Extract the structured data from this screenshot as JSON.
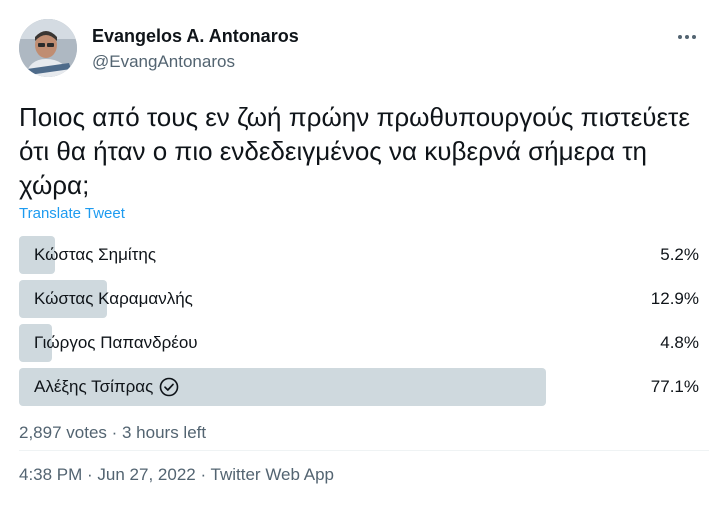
{
  "author": {
    "name": "Evangelos A. Antonaros",
    "handle": "@EvangAntonaros"
  },
  "more_icon": "more-horizontal-icon",
  "tweet_text": "Ποιος από τους εν ζωή πρώην πρωθυπουργούς πιστεύετε ότι θα ήταν ο πιο ενδεδειγμένος να κυβερνά σήμερα τη χώρα;",
  "translate_label": "Translate Tweet",
  "poll": {
    "options": [
      {
        "label": "Κώστας Σημίτης",
        "percent_label": "5.2%",
        "percent": 5.2,
        "winner": false
      },
      {
        "label": "Κώστας Καραμανλής",
        "percent_label": "12.9%",
        "percent": 12.9,
        "winner": false
      },
      {
        "label": "Γιώργος Παπανδρέου",
        "percent_label": "4.8%",
        "percent": 4.8,
        "winner": false
      },
      {
        "label": "Αλέξης Τσίπρας",
        "percent_label": "77.1%",
        "percent": 77.1,
        "winner": true
      }
    ],
    "summary": "2,897 votes · 3 hours left"
  },
  "timestamp": {
    "time_date": "4:38 PM · Jun 27, 2022 · ",
    "app": "Twitter Web App"
  },
  "colors": {
    "bar": "#cfd9de",
    "link": "#1d9bf0",
    "muted": "#536471"
  }
}
